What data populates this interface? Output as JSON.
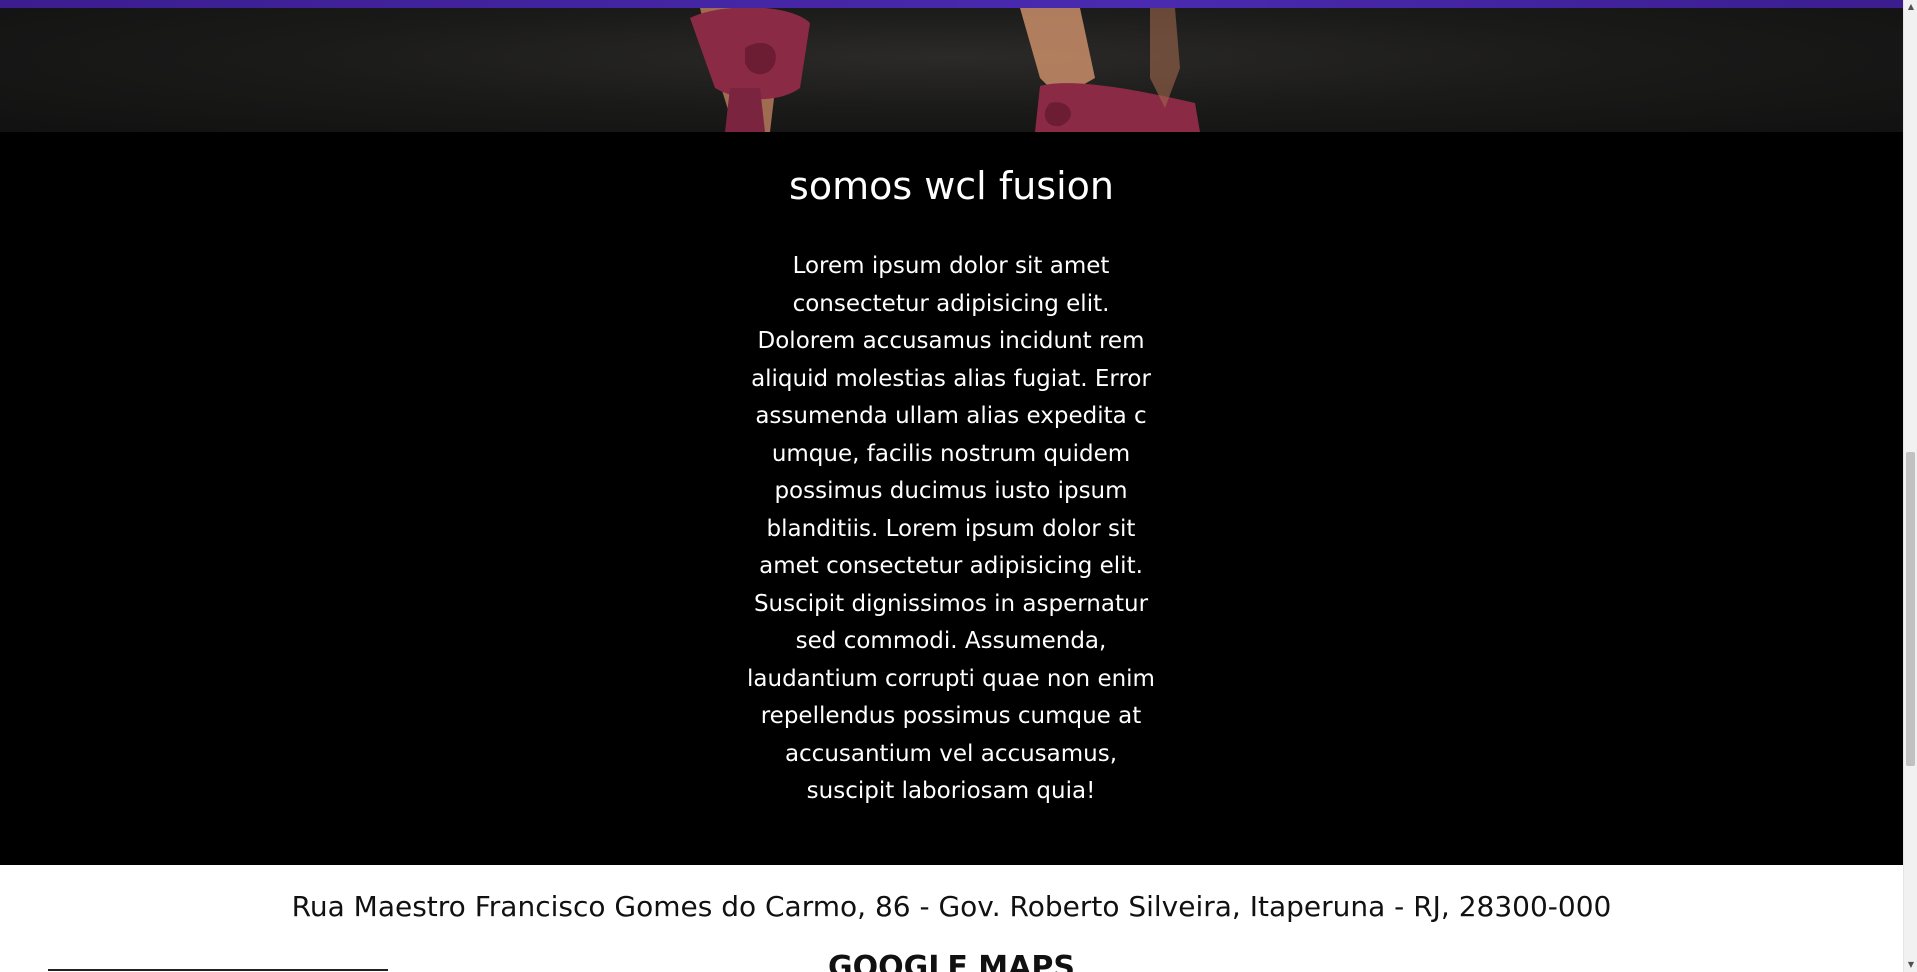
{
  "about": {
    "title": "somos wcl fusion",
    "text": "Lorem ipsum dolor sit amet consectetur adipisicing elit. Dolorem accusamus incidunt rem aliquid molestias alias fugiat. Error assumenda ullam alias expedita c umque, facilis nostrum quidem possimus ducimus iusto ipsum blanditiis. Lorem ipsum dolor sit amet consectetur adipisicing elit. Suscipit dignissimos in aspernatur sed commodi. Assumenda, laudantium corrupti quae non enim repellendus possimus cumque at accusantium vel accusamus, suscipit laboriosam quia!"
  },
  "location": {
    "address": "Rua Maestro Francisco Gomes do Carmo, 86 - Gov. Roberto Silveira, Itaperuna - RJ, 28300-000",
    "maps_heading": "GOOGLE MAPS"
  },
  "colors": {
    "accent": "#3b1d8f",
    "about_background": "#000000",
    "about_text": "#ffffff",
    "shorts": "#8b2a45"
  },
  "scrollbar": {
    "up_icon": "▲",
    "down_icon": "▼"
  }
}
